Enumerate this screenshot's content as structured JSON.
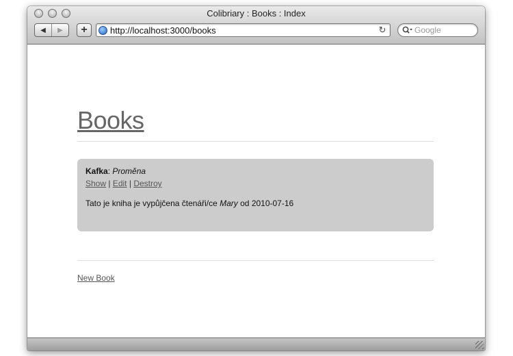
{
  "browser": {
    "window_title": "Colibriary : Books : Index",
    "back_glyph": "◀",
    "forward_glyph": "▶",
    "add_bookmark_glyph": "+",
    "url": "http://localhost:3000/books",
    "reload_glyph": "↻",
    "search_placeholder": "Google"
  },
  "page": {
    "title": "Books",
    "books": [
      {
        "author": "Kafka",
        "separator": ": ",
        "title": "Proměna",
        "actions": [
          "Show",
          "Edit",
          "Destroy"
        ],
        "action_separator": " | ",
        "loan_prefix": "Tato je kniha je vypůjčena čtenáři/ce ",
        "reader": "Mary",
        "loan_middle": " od ",
        "loan_date": "2010-07-16"
      }
    ],
    "new_book_link": "New Book"
  },
  "icons": {
    "traffic_lights": [
      "close-button",
      "minimize-button",
      "zoom-button"
    ],
    "url_icon": "globe-icon",
    "search_icon": "magnifier-icon",
    "resize": "resize-grip-icon"
  }
}
